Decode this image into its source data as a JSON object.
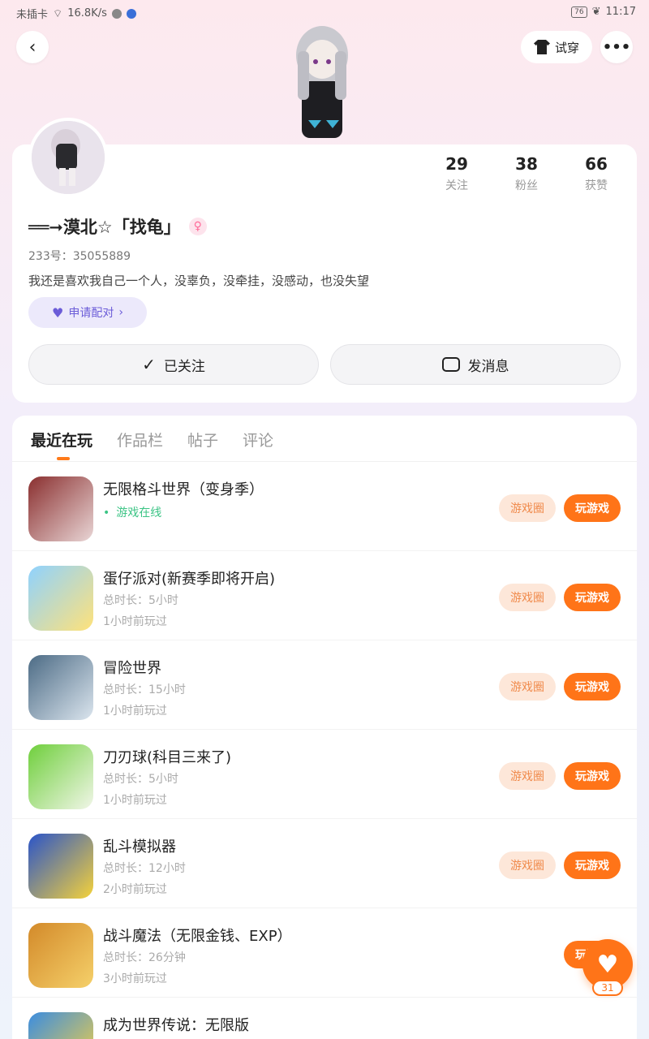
{
  "status_bar": {
    "carrier": "未插卡",
    "speed": "16.8K/s",
    "battery": "76",
    "time": "11:17"
  },
  "header": {
    "tryon_label": "试穿"
  },
  "profile": {
    "stats": [
      {
        "value": "29",
        "label": "关注"
      },
      {
        "value": "38",
        "label": "粉丝"
      },
      {
        "value": "66",
        "label": "获赞"
      }
    ],
    "username": "══➞漠北☆「找龟」",
    "gender_symbol": "♀",
    "uid": "233号：35055889",
    "bio": "我还是喜欢我自己一个人，没辜负，没牵挂，没感动，也没失望",
    "pair_label": "申请配对",
    "follow_label": "已关注",
    "message_label": "发消息"
  },
  "tabs": [
    "最近在玩",
    "作品栏",
    "帖子",
    "评论"
  ],
  "games": [
    {
      "title": "无限格斗世界（变身季）",
      "status": "游戏在线",
      "colors": [
        "#8a2f2f",
        "#e9d6d6"
      ]
    },
    {
      "title": "蛋仔派对(新赛季即将开启)",
      "time": "总时长：5小时",
      "last": "1小时前玩过",
      "colors": [
        "#8fd2ff",
        "#ffe27a"
      ]
    },
    {
      "title": "冒险世界",
      "time": "总时长：15小时",
      "last": "1小时前玩过",
      "colors": [
        "#4c6b85",
        "#dbe5ee"
      ]
    },
    {
      "title": "刀刃球(科目三来了)",
      "time": "总时长：5小时",
      "last": "1小时前玩过",
      "colors": [
        "#6fcf3c",
        "#f1f6e8"
      ]
    },
    {
      "title": "乱斗模拟器",
      "time": "总时长：12小时",
      "last": "2小时前玩过",
      "colors": [
        "#2a54c9",
        "#f5d23a"
      ]
    },
    {
      "title": "战斗魔法（无限金钱、EXP）",
      "time": "总时长：26分钟",
      "last": "3小时前玩过",
      "colors": [
        "#d38a2a",
        "#f5d06a"
      ]
    },
    {
      "title": "成为世界传说：无限版",
      "colors": [
        "#3b8de0",
        "#ffd43b"
      ]
    }
  ],
  "game_buttons": {
    "circle": "游戏圈",
    "play": "玩游戏"
  },
  "float_like": {
    "count": "31"
  }
}
